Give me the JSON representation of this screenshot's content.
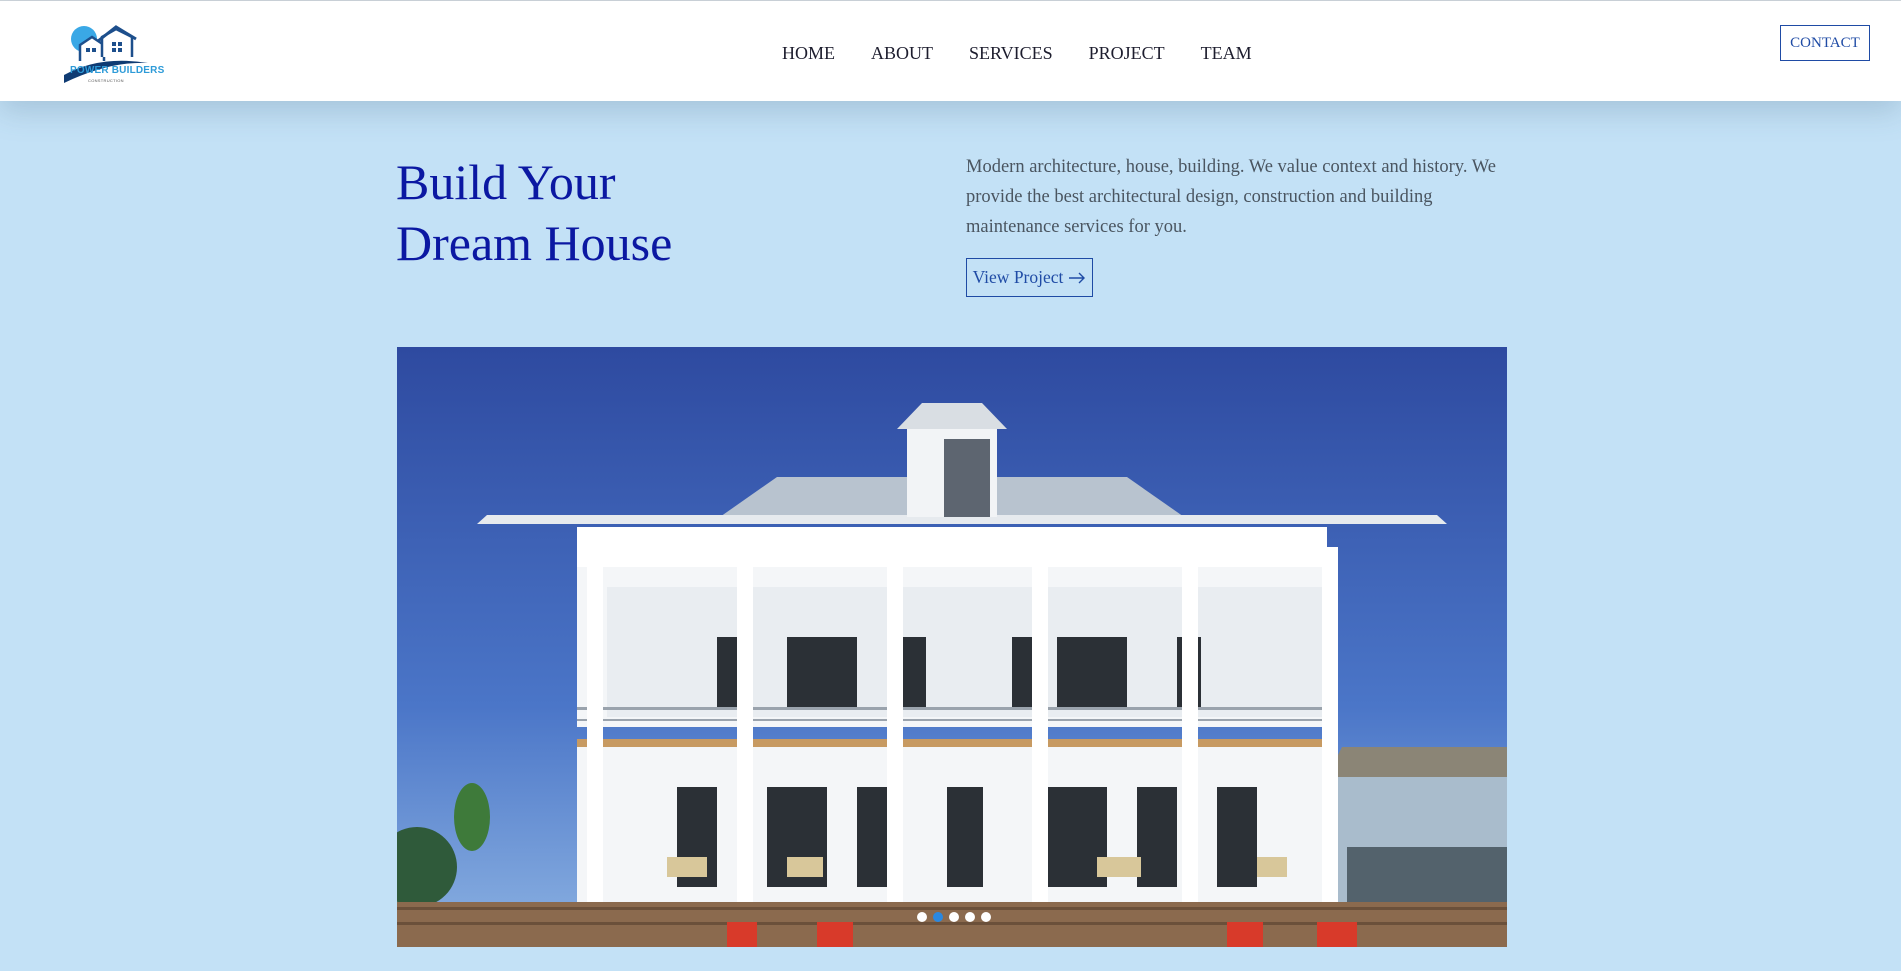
{
  "brand": {
    "name": "POWER BUILDERS",
    "tagline": "CONSTRUCTION",
    "primary_color": "#0b18a2",
    "accent_color": "#1f4ba5",
    "logo_color": "#2e9bd8"
  },
  "nav": {
    "links": [
      "HOME",
      "ABOUT",
      "SERVICES",
      "PROJECT",
      "TEAM"
    ],
    "contact_label": "CONTACT"
  },
  "hero": {
    "title_line1": "Build Your",
    "title_line2": "Dream House",
    "description": "Modern architecture, house, building. We value context and history. We provide the best architectural design, construction and building maintenance services for you.",
    "cta_label": "View Project",
    "cta_icon": "arrow-right-icon",
    "image_subject": "two-story white beach house with wraparound porches",
    "slider": {
      "slide_count": 5,
      "active_index": 1
    }
  }
}
